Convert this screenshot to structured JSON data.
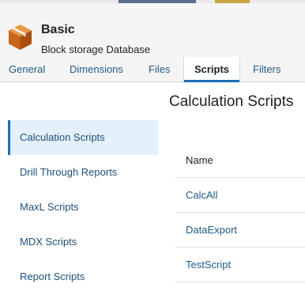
{
  "app": {
    "title": "Basic",
    "subtitle": "Block storage Database",
    "icon": "cube-icon",
    "icon_colors": {
      "front": "#c8661c",
      "side": "#a9500f",
      "top": "#e59a45"
    }
  },
  "tabs": [
    {
      "label": "General",
      "active": false
    },
    {
      "label": "Dimensions",
      "active": false
    },
    {
      "label": "Files",
      "active": false
    },
    {
      "label": "Scripts",
      "active": true
    },
    {
      "label": "Filters",
      "active": false
    }
  ],
  "sidenav": {
    "items": [
      {
        "label": "Calculation Scripts",
        "active": true
      },
      {
        "label": "Drill Through Reports",
        "active": false
      },
      {
        "label": "MaxL Scripts",
        "active": false
      },
      {
        "label": "MDX Scripts",
        "active": false
      },
      {
        "label": "Report Scripts",
        "active": false
      }
    ]
  },
  "main": {
    "title": "Calculation Scripts",
    "table": {
      "column_header": "Name",
      "rows": [
        "CalcAll",
        "DataExport",
        "TestScript"
      ]
    }
  },
  "colors": {
    "accent": "#1a6fb5",
    "link": "#1f5a86",
    "nav_active_bg": "#e4f0fa",
    "header_bg": "#f5f5f5"
  }
}
